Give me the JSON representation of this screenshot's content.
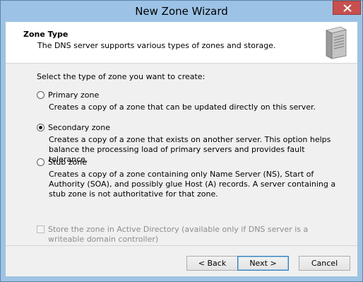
{
  "window": {
    "title": "New Zone Wizard"
  },
  "header": {
    "title": "Zone Type",
    "subtitle": "The DNS server supports various types of zones and storage.",
    "icon": "server-icon"
  },
  "content": {
    "prompt": "Select the type of zone you want to create:",
    "options": [
      {
        "label": "Primary zone",
        "description": "Creates a copy of a zone that can be updated directly on this server.",
        "selected": false
      },
      {
        "label": "Secondary zone",
        "description": "Creates a copy of a zone that exists on another server. This option helps balance the processing load of primary servers and provides fault tolerance.",
        "selected": true
      },
      {
        "label": "Stub zone",
        "description": "Creates a copy of a zone containing only Name Server (NS), Start of Authority (SOA), and possibly glue Host (A) records. A server containing a stub zone is not authoritative for that zone.",
        "selected": false
      }
    ],
    "ad_checkbox": {
      "label": "Store the zone in Active Directory (available only if DNS server is a writeable domain controller)",
      "checked": false,
      "enabled": false
    }
  },
  "footer": {
    "back_label": "< Back",
    "next_label": "Next >",
    "cancel_label": "Cancel"
  },
  "colors": {
    "titlebar": "#9cc3e6",
    "close": "#c7504f",
    "dialog_bg": "#f0f0f0"
  }
}
